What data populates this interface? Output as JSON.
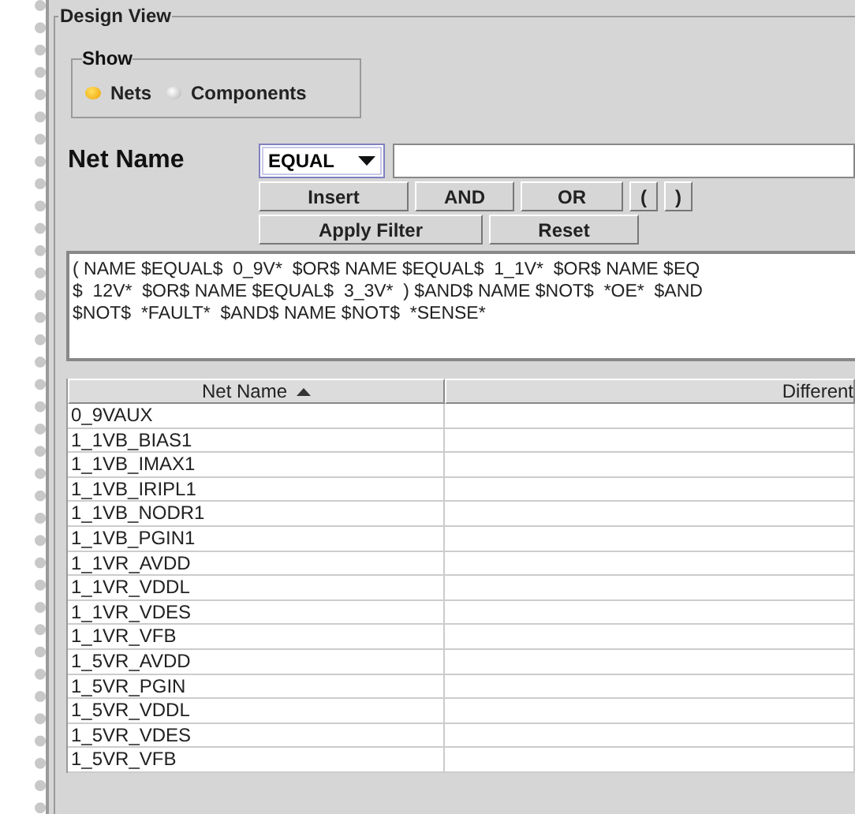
{
  "group_title": "Design View",
  "show": {
    "title": "Show",
    "options": [
      {
        "label": "Nets",
        "selected": true
      },
      {
        "label": "Components",
        "selected": false
      }
    ]
  },
  "filter": {
    "label": "Net Name",
    "operator": "EQUAL"
  },
  "buttons_row1": [
    "Insert",
    "AND",
    "OR",
    "(",
    ")"
  ],
  "buttons_row2": [
    "Apply Filter",
    "Reset"
  ],
  "expression_lines": [
    "( NAME $EQUAL$  0_9V*  $OR$ NAME $EQUAL$  1_1V*  $OR$ NAME $EQ",
    "$  12V*  $OR$ NAME $EQUAL$  3_3V*  ) $AND$ NAME $NOT$  *OE*  $AND",
    "$NOT$  *FAULT*  $AND$ NAME $NOT$  *SENSE*"
  ],
  "table": {
    "columns": [
      {
        "label": "Net Name",
        "sorted": true
      },
      {
        "label": "Different",
        "sorted": false
      }
    ],
    "rows": [
      "0_9VAUX",
      "1_1VB_BIAS1",
      "1_1VB_IMAX1",
      "1_1VB_IRIPL1",
      "1_1VB_NODR1",
      "1_1VB_PGIN1",
      "1_1VR_AVDD",
      "1_1VR_VDDL",
      "1_1VR_VDES",
      "1_1VR_VFB",
      "1_5VR_AVDD",
      "1_5VR_PGIN",
      "1_5VR_VDDL",
      "1_5VR_VDES",
      "1_5VR_VFB"
    ]
  }
}
